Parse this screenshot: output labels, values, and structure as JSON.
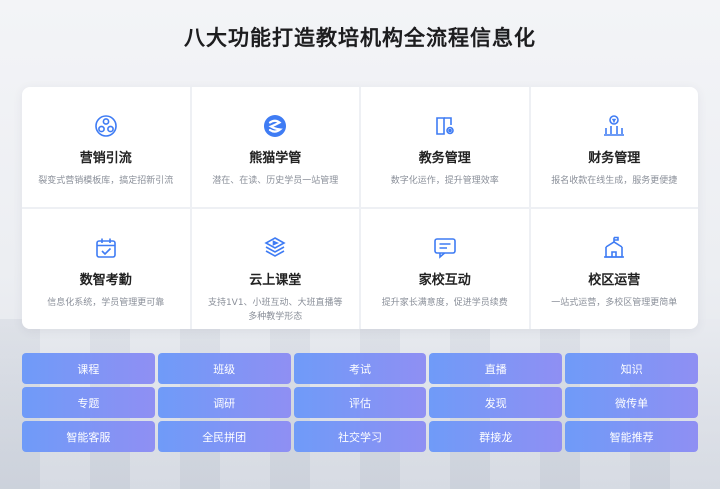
{
  "header": {
    "title": "八大功能打造教培机构全流程信息化"
  },
  "features": [
    {
      "icon": "people-network-icon",
      "title": "营销引流",
      "desc": "裂变式营销模板库，搞定招新引流"
    },
    {
      "icon": "panda-logo-icon",
      "title": "熊猫学管",
      "desc": "潜在、在读、历史学员一站管理"
    },
    {
      "icon": "book-gear-icon",
      "title": "教务管理",
      "desc": "数字化运作，提升管理效率"
    },
    {
      "icon": "finance-chart-icon",
      "title": "财务管理",
      "desc": "报名收款在线生成，服务更便捷"
    },
    {
      "icon": "calendar-check-icon",
      "title": "数智考勤",
      "desc": "信息化系统，学员管理更可靠"
    },
    {
      "icon": "cloud-play-icon",
      "title": "云上课堂",
      "desc": "支持1V1、小班互动、大班直播等多种教学形态"
    },
    {
      "icon": "chat-bubble-icon",
      "title": "家校互动",
      "desc": "提升家长满意度，促进学员续费"
    },
    {
      "icon": "school-building-icon",
      "title": "校区运营",
      "desc": "一站式运营，多校区管理更简单"
    }
  ],
  "tags": [
    "课程",
    "班级",
    "考试",
    "直播",
    "知识",
    "专题",
    "调研",
    "评估",
    "发现",
    "微传单",
    "智能客服",
    "全民拼团",
    "社交学习",
    "群接龙",
    "智能推荐"
  ],
  "colors": {
    "accent": "#3f7cf4",
    "tag_start": "#6f9bf8",
    "tag_end": "#8f8ff3"
  }
}
